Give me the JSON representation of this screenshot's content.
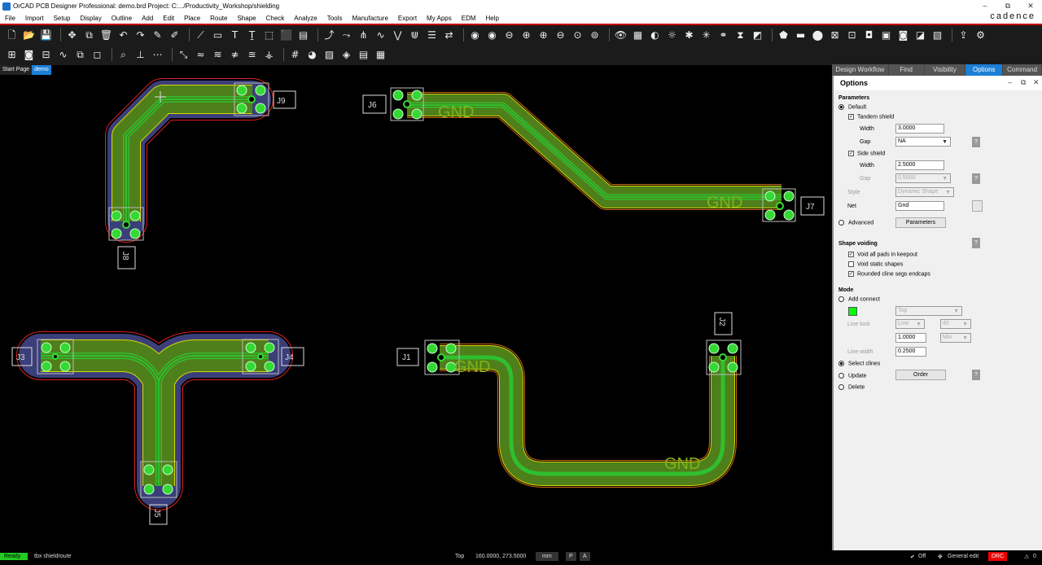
{
  "window": {
    "title": "OrCAD PCB Designer Professional: demo.brd  Project: C:.../Productivity_Workshop/shielding",
    "brand": "cadence",
    "controls": [
      "–",
      "⧉",
      "✕"
    ]
  },
  "menu": [
    "File",
    "Import",
    "Setup",
    "Display",
    "Outline",
    "Add",
    "Edit",
    "Place",
    "Route",
    "Shape",
    "Check",
    "Analyze",
    "Tools",
    "Manufacture",
    "Export",
    "My Apps",
    "EDM",
    "Help"
  ],
  "toolbar1": [
    {
      "name": "new-icon",
      "glyph": "🗋"
    },
    {
      "name": "open-icon",
      "glyph": "📂"
    },
    {
      "name": "save-icon",
      "glyph": "💾"
    },
    {
      "name": "move-icon",
      "glyph": "✥"
    },
    {
      "name": "copy-icon",
      "glyph": "⧉"
    },
    {
      "name": "delete-icon",
      "glyph": "🗑"
    },
    {
      "name": "undo-icon",
      "glyph": "↶"
    },
    {
      "name": "redo-icon",
      "glyph": "↷"
    },
    {
      "name": "pin-icon",
      "glyph": "✎"
    },
    {
      "name": "unpin-icon",
      "glyph": "✐"
    },
    {
      "name": "add-line-icon",
      "glyph": "⟋"
    },
    {
      "name": "add-rect-icon",
      "glyph": "▭"
    },
    {
      "name": "add-text-icon",
      "glyph": "T"
    },
    {
      "name": "edit-text-icon",
      "glyph": "Ṯ"
    },
    {
      "name": "place-icon",
      "glyph": "⬚"
    },
    {
      "name": "component-icon",
      "glyph": "⬛"
    },
    {
      "name": "text-box-icon",
      "glyph": "▤"
    },
    {
      "name": "add-connect-icon",
      "glyph": "⤴"
    },
    {
      "name": "slide-icon",
      "glyph": "⤳"
    },
    {
      "name": "delay-tune-icon",
      "glyph": "⋔"
    },
    {
      "name": "custom-smooth-icon",
      "glyph": "∿"
    },
    {
      "name": "fanout-icon",
      "glyph": "⋁"
    },
    {
      "name": "spread-icon",
      "glyph": "⋓"
    },
    {
      "name": "bus-icon",
      "glyph": "☰"
    },
    {
      "name": "swap-icon",
      "glyph": "⇄"
    },
    {
      "name": "drc-icon",
      "glyph": "◉"
    },
    {
      "name": "drc-update-icon",
      "glyph": "◉"
    },
    {
      "name": "zoom-fit-icon",
      "glyph": "⊖"
    },
    {
      "name": "zoom-prev-icon",
      "glyph": "⊕"
    },
    {
      "name": "zoom-in-icon",
      "glyph": "⊕"
    },
    {
      "name": "zoom-out-icon",
      "glyph": "⊖"
    },
    {
      "name": "zoom-world-icon",
      "glyph": "⊙"
    },
    {
      "name": "zoom-center-icon",
      "glyph": "⊚"
    },
    {
      "name": "view-icon",
      "glyph": "👁"
    },
    {
      "name": "color-icon",
      "glyph": "▦"
    },
    {
      "name": "shadow-icon",
      "glyph": "◐"
    },
    {
      "name": "highlight-icon",
      "glyph": "☼"
    },
    {
      "name": "dehighlight-icon",
      "glyph": "✱"
    },
    {
      "name": "ratsnest-icon",
      "glyph": "✳"
    },
    {
      "name": "unrats-icon",
      "glyph": "⚭"
    },
    {
      "name": "hourglass-icon",
      "glyph": "⧗"
    },
    {
      "name": "flip-icon",
      "glyph": "◩"
    },
    {
      "name": "shape-icon",
      "glyph": "⬟"
    },
    {
      "name": "shape-edit-icon",
      "glyph": "▬"
    },
    {
      "name": "shape-void-icon",
      "glyph": "⬤"
    },
    {
      "name": "shape-merge-icon",
      "glyph": "⊠"
    },
    {
      "name": "shape-check-icon",
      "glyph": "⊡"
    },
    {
      "name": "shape-select-icon",
      "glyph": "◘"
    },
    {
      "name": "shape-dynamic-icon",
      "glyph": "▣"
    },
    {
      "name": "shape-static-icon",
      "glyph": "◙"
    },
    {
      "name": "shape-fill-icon",
      "glyph": "◪"
    },
    {
      "name": "stackup-icon",
      "glyph": "▧"
    },
    {
      "name": "export-icon",
      "glyph": "⇪"
    },
    {
      "name": "manufacture-icon",
      "glyph": "⚙"
    }
  ],
  "toolbar2": [
    {
      "name": "sch-icon",
      "glyph": "⊞"
    },
    {
      "name": "pad-icon",
      "glyph": "◙"
    },
    {
      "name": "net-icon",
      "glyph": "⊟"
    },
    {
      "name": "wave-icon",
      "glyph": "∿"
    },
    {
      "name": "frame-icon",
      "glyph": "⧉"
    },
    {
      "name": "board-icon",
      "glyph": "◻"
    },
    {
      "name": "measure-icon",
      "glyph": "⌕"
    },
    {
      "name": "dimension-icon",
      "glyph": "⊥"
    },
    {
      "name": "spacing-icon",
      "glyph": "⋯"
    },
    {
      "name": "route-icon",
      "glyph": "⤡"
    },
    {
      "name": "diffpair-icon",
      "glyph": "≈"
    },
    {
      "name": "tune-icon",
      "glyph": "≋"
    },
    {
      "name": "phase-icon",
      "glyph": "≉"
    },
    {
      "name": "shield-icon",
      "glyph": "≊"
    },
    {
      "name": "breakout-icon",
      "glyph": "⚶"
    },
    {
      "name": "grid-icon",
      "glyph": "#"
    },
    {
      "name": "colorwheel-icon",
      "glyph": "◕"
    },
    {
      "name": "palette-icon",
      "glyph": "▨"
    },
    {
      "name": "layers-icon",
      "glyph": "◈"
    },
    {
      "name": "report-icon",
      "glyph": "▤"
    },
    {
      "name": "cmd-icon",
      "glyph": "▦"
    }
  ],
  "docTabs": [
    {
      "label": "Start Page",
      "active": false
    },
    {
      "label": "demo",
      "active": true
    }
  ],
  "canvas": {
    "labels": [
      {
        "id": "j9",
        "text": "J9"
      },
      {
        "id": "j6",
        "text": "J6"
      },
      {
        "id": "j7",
        "text": "J7"
      },
      {
        "id": "j8",
        "text": "J8"
      },
      {
        "id": "j3",
        "text": "J3"
      },
      {
        "id": "j4",
        "text": "J4"
      },
      {
        "id": "j1",
        "text": "J1"
      },
      {
        "id": "j2",
        "text": "J2"
      },
      {
        "id": "j5",
        "text": "J5"
      }
    ],
    "netLabels": [
      {
        "id": "gnd1",
        "text": "GND"
      },
      {
        "id": "gnd2",
        "text": "GND"
      },
      {
        "id": "gnd3",
        "text": "GND"
      },
      {
        "id": "gnd4",
        "text": "GND"
      }
    ],
    "colors": {
      "copper": "#4f7f1a",
      "trace": "#2fbf2f",
      "shield_outline": "#d8d800",
      "keepout": "#e02020",
      "plane": "#3a3f7a",
      "pad": "#36d836",
      "pad_ring": "#c9ffc9",
      "gnd_text": "#7fb31a"
    }
  },
  "rightTabs": [
    {
      "label": "Design Workflow",
      "active": false
    },
    {
      "label": "Find",
      "active": false
    },
    {
      "label": "Visibility",
      "active": false
    },
    {
      "label": "Options",
      "active": true
    },
    {
      "label": "Command",
      "active": false
    }
  ],
  "options": {
    "title": "Options",
    "header_buttons": [
      "–",
      "⧉",
      "✕"
    ],
    "parameters": "Parameters",
    "default": "Default",
    "tandem_shield": "Tandem shield",
    "tandem_width_label": "Width",
    "tandem_width": "3.0000",
    "tandem_gap_label": "Gap",
    "tandem_gap": "NA",
    "side_shield": "Side shield",
    "side_width_label": "Width",
    "side_width": "2.5000",
    "side_gap_label": "Gap",
    "side_gap": "0.5000",
    "style_label": "Style",
    "style": "Dynamic Shape",
    "net_label": "Net",
    "net": "Gnd",
    "advanced": "Advanced",
    "parameters_button": "Parameters",
    "shape_voiding": "Shape voiding",
    "void_all_pads": "Void all pads in keepout",
    "void_static": "Void static shapes",
    "rounded_endcaps": "Rounded cline segs endcaps",
    "mode": "Mode",
    "add_connect": "Add connect",
    "layer": "Top",
    "line_lock_label": "Line lock",
    "line_lock": "Line",
    "line_lock_angle": "45",
    "line_lock_value": "1.0000",
    "line_lock_min": "Min",
    "line_width_label": "Line width",
    "line_width": "0.2500",
    "select_clines": "Select clines",
    "update": "Update",
    "order_button": "Order",
    "delete": "Delete",
    "help": "?"
  },
  "status": {
    "ready": "Ready",
    "command": "tbx shieldroute",
    "layer": "Top",
    "coords": "160.0000, 273.5000",
    "units": "mm",
    "p": "P",
    "a": "A",
    "off": "Off",
    "mode": "General edit",
    "drc": "DRC",
    "drc_count": "0"
  }
}
